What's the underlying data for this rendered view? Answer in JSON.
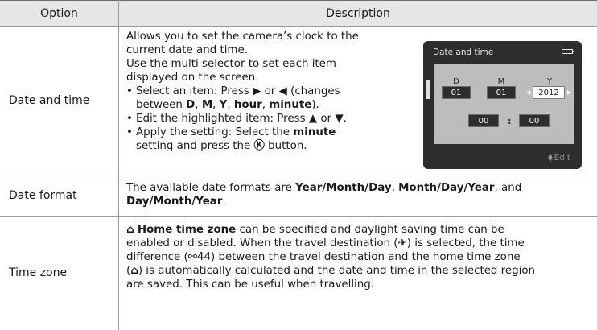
{
  "header": {
    "option": "Option",
    "description": "Description"
  },
  "rows": [
    {
      "option": "Date and time",
      "lines": [
        "Allows you to set the camera’s clock to the",
        "current date and time.",
        "Use the multi selector to set each item",
        "displayed on the screen."
      ],
      "bullet1": {
        "pre": "Select an item: Press ▶ or ◀ (changes",
        "line2_pre": "between ",
        "D": "D",
        "M": "M",
        "Y": "Y",
        "hour": "hour",
        "minute": "minute",
        "post": ")."
      },
      "bullet2": "Edit the highlighted item: Press ▲ or ▼.",
      "bullet3": {
        "pre": "Apply the setting: Select the ",
        "bold": "minute",
        "line2": "setting and press the ",
        "ok": "Ⓚ",
        "post": " button."
      },
      "screen": {
        "title": "Date and time",
        "d_label": "D",
        "m_label": "M",
        "y_label": "Y",
        "d_value": "01",
        "m_value": "01",
        "y_value": "2012",
        "hour_value": "00",
        "minute_value": "00",
        "colon": ":",
        "edit": "Edit"
      }
    },
    {
      "option": "Date format",
      "pre": "The available date formats are ",
      "f1": "Year/Month/Day",
      "sep": ", ",
      "f2": "Month/Day/Year",
      "and": ", and",
      "f3": "Day/Month/Year",
      "end": "."
    },
    {
      "option": "Time zone",
      "home_icon": "⌂",
      "home_bold": "Home time zone",
      "l1": " can be specified and daylight saving time can be",
      "l2": "enabled or disabled. When the travel destination (✈) is selected, the time",
      "l3": "difference (⚯44) between the travel destination and the home time zone",
      "l4_pre": "(",
      "l4_icon": "⌂",
      "l4_post": ") is automatically calculated and the date and time in the selected region",
      "l5": "are saved. This can be useful when travelling."
    }
  ]
}
